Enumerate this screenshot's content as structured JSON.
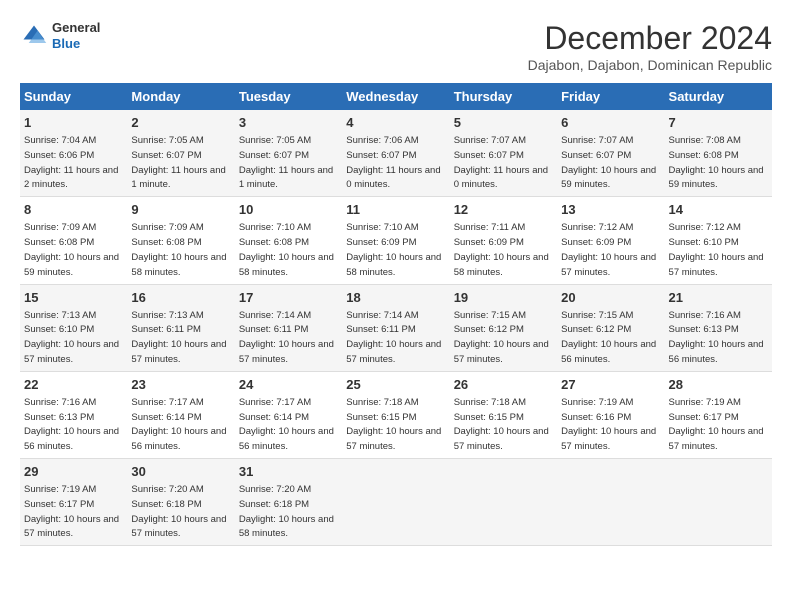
{
  "header": {
    "logo_general": "General",
    "logo_blue": "Blue",
    "month_title": "December 2024",
    "location": "Dajabon, Dajabon, Dominican Republic"
  },
  "calendar": {
    "weekdays": [
      "Sunday",
      "Monday",
      "Tuesday",
      "Wednesday",
      "Thursday",
      "Friday",
      "Saturday"
    ],
    "weeks": [
      [
        {
          "day": "1",
          "sunrise": "7:04 AM",
          "sunset": "6:06 PM",
          "daylight": "11 hours and 2 minutes."
        },
        {
          "day": "2",
          "sunrise": "7:05 AM",
          "sunset": "6:07 PM",
          "daylight": "11 hours and 1 minute."
        },
        {
          "day": "3",
          "sunrise": "7:05 AM",
          "sunset": "6:07 PM",
          "daylight": "11 hours and 1 minute."
        },
        {
          "day": "4",
          "sunrise": "7:06 AM",
          "sunset": "6:07 PM",
          "daylight": "11 hours and 0 minutes."
        },
        {
          "day": "5",
          "sunrise": "7:07 AM",
          "sunset": "6:07 PM",
          "daylight": "11 hours and 0 minutes."
        },
        {
          "day": "6",
          "sunrise": "7:07 AM",
          "sunset": "6:07 PM",
          "daylight": "10 hours and 59 minutes."
        },
        {
          "day": "7",
          "sunrise": "7:08 AM",
          "sunset": "6:08 PM",
          "daylight": "10 hours and 59 minutes."
        }
      ],
      [
        {
          "day": "8",
          "sunrise": "7:09 AM",
          "sunset": "6:08 PM",
          "daylight": "10 hours and 59 minutes."
        },
        {
          "day": "9",
          "sunrise": "7:09 AM",
          "sunset": "6:08 PM",
          "daylight": "10 hours and 58 minutes."
        },
        {
          "day": "10",
          "sunrise": "7:10 AM",
          "sunset": "6:08 PM",
          "daylight": "10 hours and 58 minutes."
        },
        {
          "day": "11",
          "sunrise": "7:10 AM",
          "sunset": "6:09 PM",
          "daylight": "10 hours and 58 minutes."
        },
        {
          "day": "12",
          "sunrise": "7:11 AM",
          "sunset": "6:09 PM",
          "daylight": "10 hours and 58 minutes."
        },
        {
          "day": "13",
          "sunrise": "7:12 AM",
          "sunset": "6:09 PM",
          "daylight": "10 hours and 57 minutes."
        },
        {
          "day": "14",
          "sunrise": "7:12 AM",
          "sunset": "6:10 PM",
          "daylight": "10 hours and 57 minutes."
        }
      ],
      [
        {
          "day": "15",
          "sunrise": "7:13 AM",
          "sunset": "6:10 PM",
          "daylight": "10 hours and 57 minutes."
        },
        {
          "day": "16",
          "sunrise": "7:13 AM",
          "sunset": "6:11 PM",
          "daylight": "10 hours and 57 minutes."
        },
        {
          "day": "17",
          "sunrise": "7:14 AM",
          "sunset": "6:11 PM",
          "daylight": "10 hours and 57 minutes."
        },
        {
          "day": "18",
          "sunrise": "7:14 AM",
          "sunset": "6:11 PM",
          "daylight": "10 hours and 57 minutes."
        },
        {
          "day": "19",
          "sunrise": "7:15 AM",
          "sunset": "6:12 PM",
          "daylight": "10 hours and 57 minutes."
        },
        {
          "day": "20",
          "sunrise": "7:15 AM",
          "sunset": "6:12 PM",
          "daylight": "10 hours and 56 minutes."
        },
        {
          "day": "21",
          "sunrise": "7:16 AM",
          "sunset": "6:13 PM",
          "daylight": "10 hours and 56 minutes."
        }
      ],
      [
        {
          "day": "22",
          "sunrise": "7:16 AM",
          "sunset": "6:13 PM",
          "daylight": "10 hours and 56 minutes."
        },
        {
          "day": "23",
          "sunrise": "7:17 AM",
          "sunset": "6:14 PM",
          "daylight": "10 hours and 56 minutes."
        },
        {
          "day": "24",
          "sunrise": "7:17 AM",
          "sunset": "6:14 PM",
          "daylight": "10 hours and 56 minutes."
        },
        {
          "day": "25",
          "sunrise": "7:18 AM",
          "sunset": "6:15 PM",
          "daylight": "10 hours and 57 minutes."
        },
        {
          "day": "26",
          "sunrise": "7:18 AM",
          "sunset": "6:15 PM",
          "daylight": "10 hours and 57 minutes."
        },
        {
          "day": "27",
          "sunrise": "7:19 AM",
          "sunset": "6:16 PM",
          "daylight": "10 hours and 57 minutes."
        },
        {
          "day": "28",
          "sunrise": "7:19 AM",
          "sunset": "6:17 PM",
          "daylight": "10 hours and 57 minutes."
        }
      ],
      [
        {
          "day": "29",
          "sunrise": "7:19 AM",
          "sunset": "6:17 PM",
          "daylight": "10 hours and 57 minutes."
        },
        {
          "day": "30",
          "sunrise": "7:20 AM",
          "sunset": "6:18 PM",
          "daylight": "10 hours and 57 minutes."
        },
        {
          "day": "31",
          "sunrise": "7:20 AM",
          "sunset": "6:18 PM",
          "daylight": "10 hours and 58 minutes."
        },
        null,
        null,
        null,
        null
      ]
    ]
  }
}
